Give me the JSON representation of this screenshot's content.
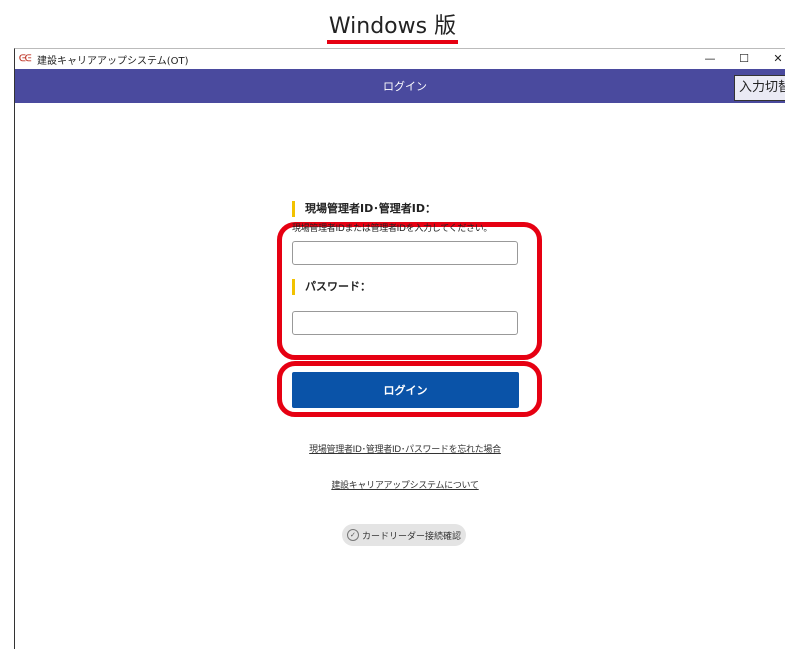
{
  "caption": {
    "title": "Windows 版"
  },
  "window": {
    "title": "建設キャリアアップシステム(OT)",
    "controls": {
      "minimize": "—",
      "maximize": "☐",
      "close": "✕"
    }
  },
  "appbar": {
    "title": "ログイン",
    "input_switch_label": "入力切替"
  },
  "form": {
    "id_label": "現場管理者ID･管理者ID：",
    "id_hint": "現場管理者IDまたは管理者IDを入力してください。",
    "id_value": "",
    "password_label": "パスワード：",
    "password_value": ""
  },
  "login_button": "ログイン",
  "links": {
    "forgot": "現場管理者ID･管理者ID･パスワードを忘れた場合",
    "about": "建設キャリアアップシステムについて"
  },
  "card_reader_button": "カードリーダー接続確認",
  "colors": {
    "appbar": "#4a4a9e",
    "login_button": "#0a53a8",
    "highlight": "#e60012",
    "label_accent": "#f2c200"
  }
}
